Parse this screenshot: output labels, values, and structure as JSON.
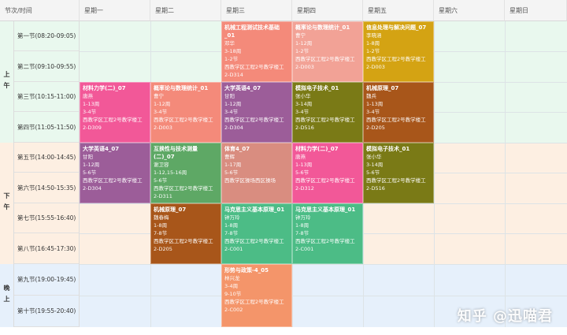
{
  "header": {
    "corner": "节次/时间",
    "days": [
      "星期一",
      "星期二",
      "星期三",
      "星期四",
      "星期五",
      "星期六",
      "星期日"
    ]
  },
  "periods": {
    "morning": "上午",
    "afternoon": "下午",
    "evening": "晚上"
  },
  "slots": [
    "第一节(08:20-09:05)",
    "第二节(09:10-09:55)",
    "第三节(10:15-11:00)",
    "第四节(11:05-11:50)",
    "第五节(14:00-14:45)",
    "第六节(14:50-15:35)",
    "第七节(15:55-16:40)",
    "第八节(16:45-17:30)",
    "第九节(19:00-19:45)",
    "第十节(19:55-20:40)"
  ],
  "courses": {
    "wed_12": {
      "title": "机械工程测试技术基础_01",
      "teacher": "邓华",
      "weeks": "3-18周",
      "sections": "1-2节",
      "room": "西教学区工程2号教学楼工2-D314",
      "color": "#f48a7a"
    },
    "thu_12": {
      "title": "概率论与数理统计_01",
      "teacher": "曹宁",
      "weeks": "1-12周",
      "sections": "1-2节",
      "room": "西教学区工程2号教学楼工2-D003",
      "color": "#f2a296"
    },
    "fri_12": {
      "title": "信息处理与解决问题_07",
      "teacher": "李晓涵",
      "weeks": "1-8周",
      "sections": "1-2节",
      "room": "西教学区工程2号教学楼工2-D003",
      "color": "#d4a313"
    },
    "mon_34": {
      "title": "材料力学(二)_07",
      "teacher": "唐燕",
      "weeks": "1-13周",
      "sections": "3-4节",
      "room": "西教学区工程2号教学楼工2-D309",
      "color": "#f25898"
    },
    "tue_34": {
      "title": "概率论与数理统计_01",
      "teacher": "曹宁",
      "weeks": "1-12周",
      "sections": "3-4节",
      "room": "西教学区工程2号教学楼工2-D003",
      "color": "#f48a7a"
    },
    "wed_34": {
      "title": "大学英语4_07",
      "teacher": "甘阳",
      "weeks": "1-12周",
      "sections": "3-4节",
      "room": "西教学区工程2号教学楼工2-D304",
      "color": "#9c5d99"
    },
    "thu_34": {
      "title": "模拟电子技术_01",
      "teacher": "张小华",
      "weeks": "3-14周",
      "sections": "3-4节",
      "room": "西教学区工程2号教学楼工2-D516",
      "color": "#7a7a16"
    },
    "fri_34": {
      "title": "机械原理_07",
      "teacher": "魏兵",
      "weeks": "1-13周",
      "sections": "3-4节",
      "room": "西教学区工程2号教学楼工2-D205",
      "color": "#a8561a"
    },
    "mon_56": {
      "title": "大学英语4_07",
      "teacher": "甘阳",
      "weeks": "1-12周",
      "sections": "5-6节",
      "room": "西教学区工程2号教学楼工2-D304",
      "color": "#9c5d99"
    },
    "tue_56": {
      "title": "互换性与技术测量(二)_07",
      "teacher": "谢卫容",
      "weeks": "1-12,15-16周",
      "sections": "5-6节",
      "room": "西教学区工程2号教学楼工2-D311",
      "color": "#5ea865"
    },
    "wed_56": {
      "title": "体育4_07",
      "teacher": "曹辉",
      "weeks": "1-17周",
      "sections": "5-6节",
      "room": "西教学区操场西区操场",
      "color": "#d98d80"
    },
    "thu_56": {
      "title": "材料力学(二)_07",
      "teacher": "唐燕",
      "weeks": "1-13周",
      "sections": "5-6节",
      "room": "西教学区工程2号教学楼工2-D312",
      "color": "#f25898"
    },
    "fri_56": {
      "title": "模拟电子技术_01",
      "teacher": "张小华",
      "weeks": "3-14周",
      "sections": "5-6节",
      "room": "西教学区工程2号教学楼工2-D516",
      "color": "#7a7a16"
    },
    "tue_78": {
      "title": "机械原理_07",
      "teacher": "魏春梅",
      "weeks": "1-8周",
      "sections": "7-8节",
      "room": "西教学区工程2号教学楼工2-D205",
      "color": "#a8561a"
    },
    "wed_78": {
      "title": "马克思主义基本原理_01",
      "teacher": "钟万玲",
      "weeks": "1-8周",
      "sections": "7-8节",
      "room": "西教学区工程2号教学楼工2-C001",
      "color": "#4cbc86"
    },
    "thu_78": {
      "title": "马克思主义基本原理_01",
      "teacher": "钟万玲",
      "weeks": "1-8周",
      "sections": "7-8节",
      "room": "西教学区工程2号教学楼工2-C001",
      "color": "#4cbc86"
    },
    "wed_910": {
      "title": "形势与政策-4_05",
      "teacher": "林兴龙",
      "weeks": "3-4周",
      "sections": "9-10节",
      "room": "西教学区工程2号教学楼工2-C002",
      "color": "#f4956a"
    }
  },
  "watermark": "知乎 @迅喵君"
}
